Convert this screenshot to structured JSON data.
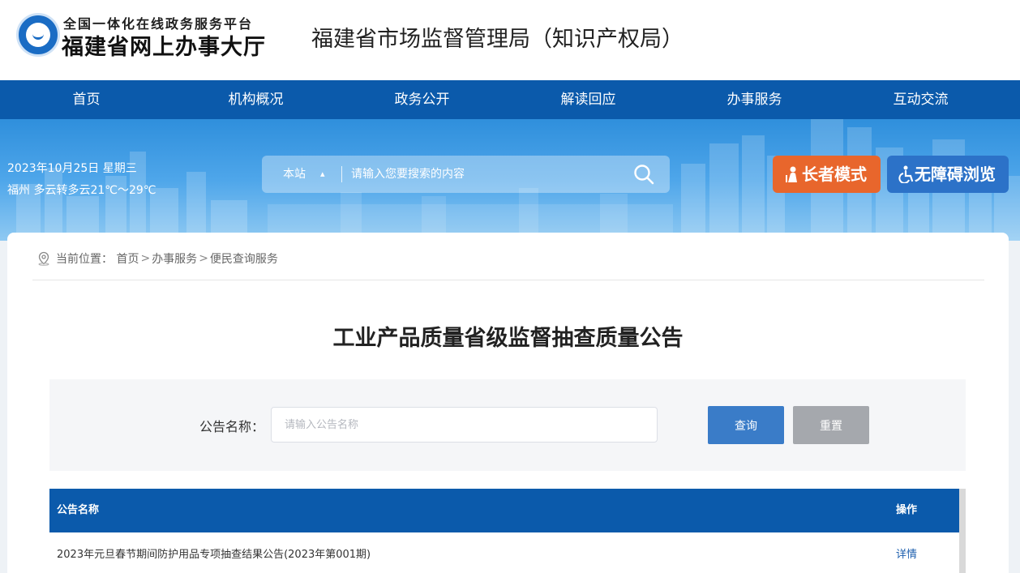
{
  "header": {
    "platform_name": "全国一体化在线政务服务平台",
    "hall_name": "福建省网上办事大厅",
    "site_title": "福建省市场监督管理局（知识产权局）"
  },
  "nav": {
    "items": [
      "首页",
      "机构概况",
      "政务公开",
      "解读回应",
      "办事服务",
      "互动交流"
    ]
  },
  "banner": {
    "date": "2023年10月25日 星期三",
    "weather": "福州 多云转多云21℃～29℃",
    "search": {
      "scope": "本站",
      "placeholder": "请输入您要搜索的内容"
    },
    "elder_mode": "长者模式",
    "accessible": "无障碍浏览"
  },
  "breadcrumb": {
    "prefix": "当前位置：",
    "items": [
      "首页",
      "办事服务",
      "便民查询服务"
    ],
    "separator": ">"
  },
  "page": {
    "title": "工业产品质量省级监督抽查质量公告"
  },
  "filter": {
    "label": "公告名称：",
    "placeholder": "请输入公告名称",
    "value": "",
    "query_label": "查询",
    "reset_label": "重置"
  },
  "table": {
    "columns": [
      "公告名称",
      "操作"
    ],
    "rows": [
      {
        "name": "2023年元旦春节期间防护用品专项抽查结果公告(2023年第001期)",
        "action": "详情"
      }
    ]
  },
  "colors": {
    "nav_bg": "#0b5aab",
    "elder_btn": "#e8662c",
    "accessible_btn": "#2c72c8",
    "query_btn": "#3a7cc8",
    "reset_btn": "#a5a8ad"
  }
}
